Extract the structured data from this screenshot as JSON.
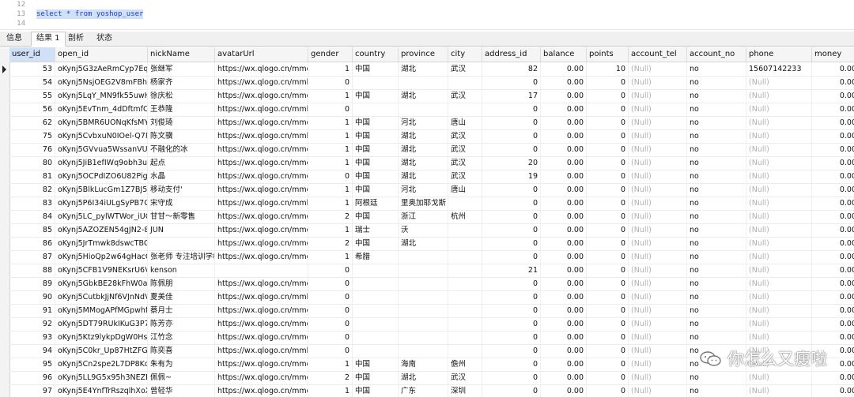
{
  "editor": {
    "lines": [
      {
        "no": "12",
        "code": ""
      },
      {
        "no": "13",
        "code": "select * from yoshop_user"
      },
      {
        "no": "14",
        "code": ""
      }
    ]
  },
  "tabs": [
    "信息",
    "结果 1",
    "剖析",
    "状态"
  ],
  "active_tab": 1,
  "columns": [
    "user_id",
    "open_id",
    "nickName",
    "avatarUrl",
    "gender",
    "country",
    "province",
    "city",
    "address_id",
    "balance",
    "points",
    "account_tel",
    "account_no",
    "phone",
    "money"
  ],
  "rows": [
    [
      "53",
      "oKynj5G3zAeRmCyp7EqO",
      "张继军",
      "https://wx.qlogo.cn/mmo",
      "1",
      "中国",
      "湖北",
      "武汉",
      "82",
      "0.00",
      "10",
      "(Null)",
      "no",
      "15607142233",
      "0.00"
    ],
    [
      "54",
      "oKynj5NsjOEG2V8mFBhO",
      "杨家齐",
      "https://wx.qlogo.cn/mmh",
      "0",
      "",
      "",
      "",
      "0",
      "0.00",
      "0",
      "(Null)",
      "no",
      "(Null)",
      "0.00"
    ],
    [
      "55",
      "oKynj5LqY_MN9fk55uwHe",
      "徐庆松",
      "https://wx.qlogo.cn/mmo",
      "1",
      "中国",
      "湖北",
      "武汉",
      "17",
      "0.00",
      "0",
      "(Null)",
      "no",
      "(Null)",
      "0.00"
    ],
    [
      "56",
      "oKynj5EvTnm_4dDftmfOU",
      "王恭隆",
      "https://wx.qlogo.cn/mmh",
      "0",
      "",
      "",
      "",
      "0",
      "0.00",
      "0",
      "(Null)",
      "no",
      "(Null)",
      "0.00"
    ],
    [
      "62",
      "oKynj5BMR6UONqKfsMY",
      "刘俊琦",
      "https://wx.qlogo.cn/mmo",
      "1",
      "中国",
      "河北",
      "唐山",
      "0",
      "0.00",
      "0",
      "(Null)",
      "no",
      "(Null)",
      "0.00"
    ],
    [
      "75",
      "oKynj5CvbxuN0IOel-Q7M",
      "陈文骥",
      "https://wx.qlogo.cn/mmh",
      "1",
      "中国",
      "湖北",
      "武汉",
      "0",
      "0.00",
      "0",
      "(Null)",
      "no",
      "(Null)",
      "0.00"
    ],
    [
      "76",
      "oKynj5GVvua5WssanVUC",
      "不融化的冰",
      "https://wx.qlogo.cn/mmo",
      "1",
      "中国",
      "湖北",
      "武汉",
      "0",
      "0.00",
      "0",
      "(Null)",
      "no",
      "(Null)",
      "0.00"
    ],
    [
      "80",
      "oKynj5JiB1efIWq9obh3u1",
      "起点",
      "https://wx.qlogo.cn/mmo",
      "1",
      "中国",
      "湖北",
      "武汉",
      "20",
      "0.00",
      "0",
      "(Null)",
      "no",
      "(Null)",
      "0.00"
    ],
    [
      "81",
      "oKynj5OCPdIZO6U82Pigz",
      "水晶",
      "https://wx.qlogo.cn/mmo",
      "0",
      "中国",
      "湖北",
      "武汉",
      "19",
      "0.00",
      "0",
      "(Null)",
      "no",
      "(Null)",
      "0.00"
    ],
    [
      "82",
      "oKynj5BlkLucGm1Z7BJ5zr",
      "移动支付'",
      "https://wx.qlogo.cn/mmo",
      "1",
      "中国",
      "河北",
      "唐山",
      "0",
      "0.00",
      "0",
      "(Null)",
      "no",
      "(Null)",
      "0.00"
    ],
    [
      "83",
      "oKynj5P6I34iULgSyPB7Ccl",
      "宋守成",
      "https://wx.qlogo.cn/mmh",
      "1",
      "阿根廷",
      "里奥加耶戈斯",
      "",
      "0",
      "0.00",
      "0",
      "(Null)",
      "no",
      "(Null)",
      "0.00"
    ],
    [
      "84",
      "oKynj5LC_pylWTWor_iUC",
      "甘甘～新零售",
      "https://wx.qlogo.cn/mmo",
      "2",
      "中国",
      "浙江",
      "杭州",
      "0",
      "0.00",
      "0",
      "(Null)",
      "no",
      "(Null)",
      "0.00"
    ],
    [
      "85",
      "oKynj5AZOZEN54gJN2-8e",
      "JUN",
      "https://wx.qlogo.cn/mmo",
      "1",
      "瑞士",
      "沃",
      "",
      "0",
      "0.00",
      "0",
      "(Null)",
      "no",
      "(Null)",
      "0.00"
    ],
    [
      "86",
      "oKynj5JrTmwk8dswcTBC-",
      "",
      "https://wx.qlogo.cn/mmo",
      "2",
      "中国",
      "湖北",
      "",
      "0",
      "0.00",
      "0",
      "(Null)",
      "no",
      "(Null)",
      "0.00"
    ],
    [
      "87",
      "oKynj5HioQp2w64gHacGi",
      "张老师 专注培训学校",
      "https://wx.qlogo.cn/mmo",
      "1",
      "希腊",
      "",
      "",
      "0",
      "0.00",
      "0",
      "(Null)",
      "no",
      "(Null)",
      "0.00"
    ],
    [
      "88",
      "oKynj5CFB1V9NEKsrU6VE",
      "kenson",
      "",
      "0",
      "",
      "",
      "",
      "21",
      "0.00",
      "0",
      "(Null)",
      "no",
      "(Null)",
      "0.00"
    ],
    [
      "89",
      "oKynj5GbkBE28kFhW0akl",
      "陈佩朋",
      "https://wx.qlogo.cn/mmo",
      "0",
      "",
      "",
      "",
      "0",
      "0.00",
      "0",
      "(Null)",
      "no",
      "(Null)",
      "0.00"
    ],
    [
      "90",
      "oKynj5CutbkJjNf6VJnNdV",
      "夏美佳",
      "https://wx.qlogo.cn/mmh",
      "0",
      "",
      "",
      "",
      "0",
      "0.00",
      "0",
      "(Null)",
      "no",
      "(Null)",
      "0.00"
    ],
    [
      "91",
      "oKynj5MMogAPfMGpwhf",
      "蔡月士",
      "https://wx.qlogo.cn/mmo",
      "0",
      "",
      "",
      "",
      "0",
      "0.00",
      "0",
      "(Null)",
      "no",
      "(Null)",
      "0.00"
    ],
    [
      "92",
      "oKynj5DT79RUkIKuG3P7V",
      "陈芳亦",
      "https://wx.qlogo.cn/mmo",
      "0",
      "",
      "",
      "",
      "0",
      "0.00",
      "0",
      "(Null)",
      "no",
      "(Null)",
      "0.00"
    ],
    [
      "93",
      "oKynj5Ktz9lykpDgW0Hsr",
      "江竹念",
      "https://wx.qlogo.cn/mmo",
      "0",
      "",
      "",
      "",
      "0",
      "0.00",
      "0",
      "(Null)",
      "no",
      "(Null)",
      "0.00"
    ],
    [
      "94",
      "oKynj5C0kr_Up87HtZFGN",
      "陈奕喜",
      "https://wx.qlogo.cn/mmh",
      "0",
      "",
      "",
      "",
      "0",
      "0.00",
      "0",
      "(Null)",
      "no",
      "(Null)",
      "0.00"
    ],
    [
      "95",
      "oKynj5Cn2spe2L7DP8Kq2",
      "朱有为",
      "https://wx.qlogo.cn/mmo",
      "1",
      "中国",
      "海南",
      "儋州",
      "0",
      "0.00",
      "0",
      "(Null)",
      "no",
      "(Null)",
      "0.00"
    ],
    [
      "96",
      "oKynj5LL9G5x95h3NEZDx",
      "佩佩~",
      "https://wx.qlogo.cn/mmo",
      "2",
      "中国",
      "湖北",
      "武汉",
      "0",
      "0.00",
      "0",
      "(Null)",
      "no",
      "(Null)",
      "0.00"
    ],
    [
      "97",
      "oKynj5E4YnfTrRszqlhXoX",
      "曾轻华",
      "https://wx.qlogo.cn/mmo",
      "1",
      "中国",
      "广东",
      "深圳",
      "0",
      "0.00",
      "0",
      "(Null)",
      "no",
      "(Null)",
      "0.00"
    ]
  ],
  "watermark": "你怎么又瘦啦"
}
